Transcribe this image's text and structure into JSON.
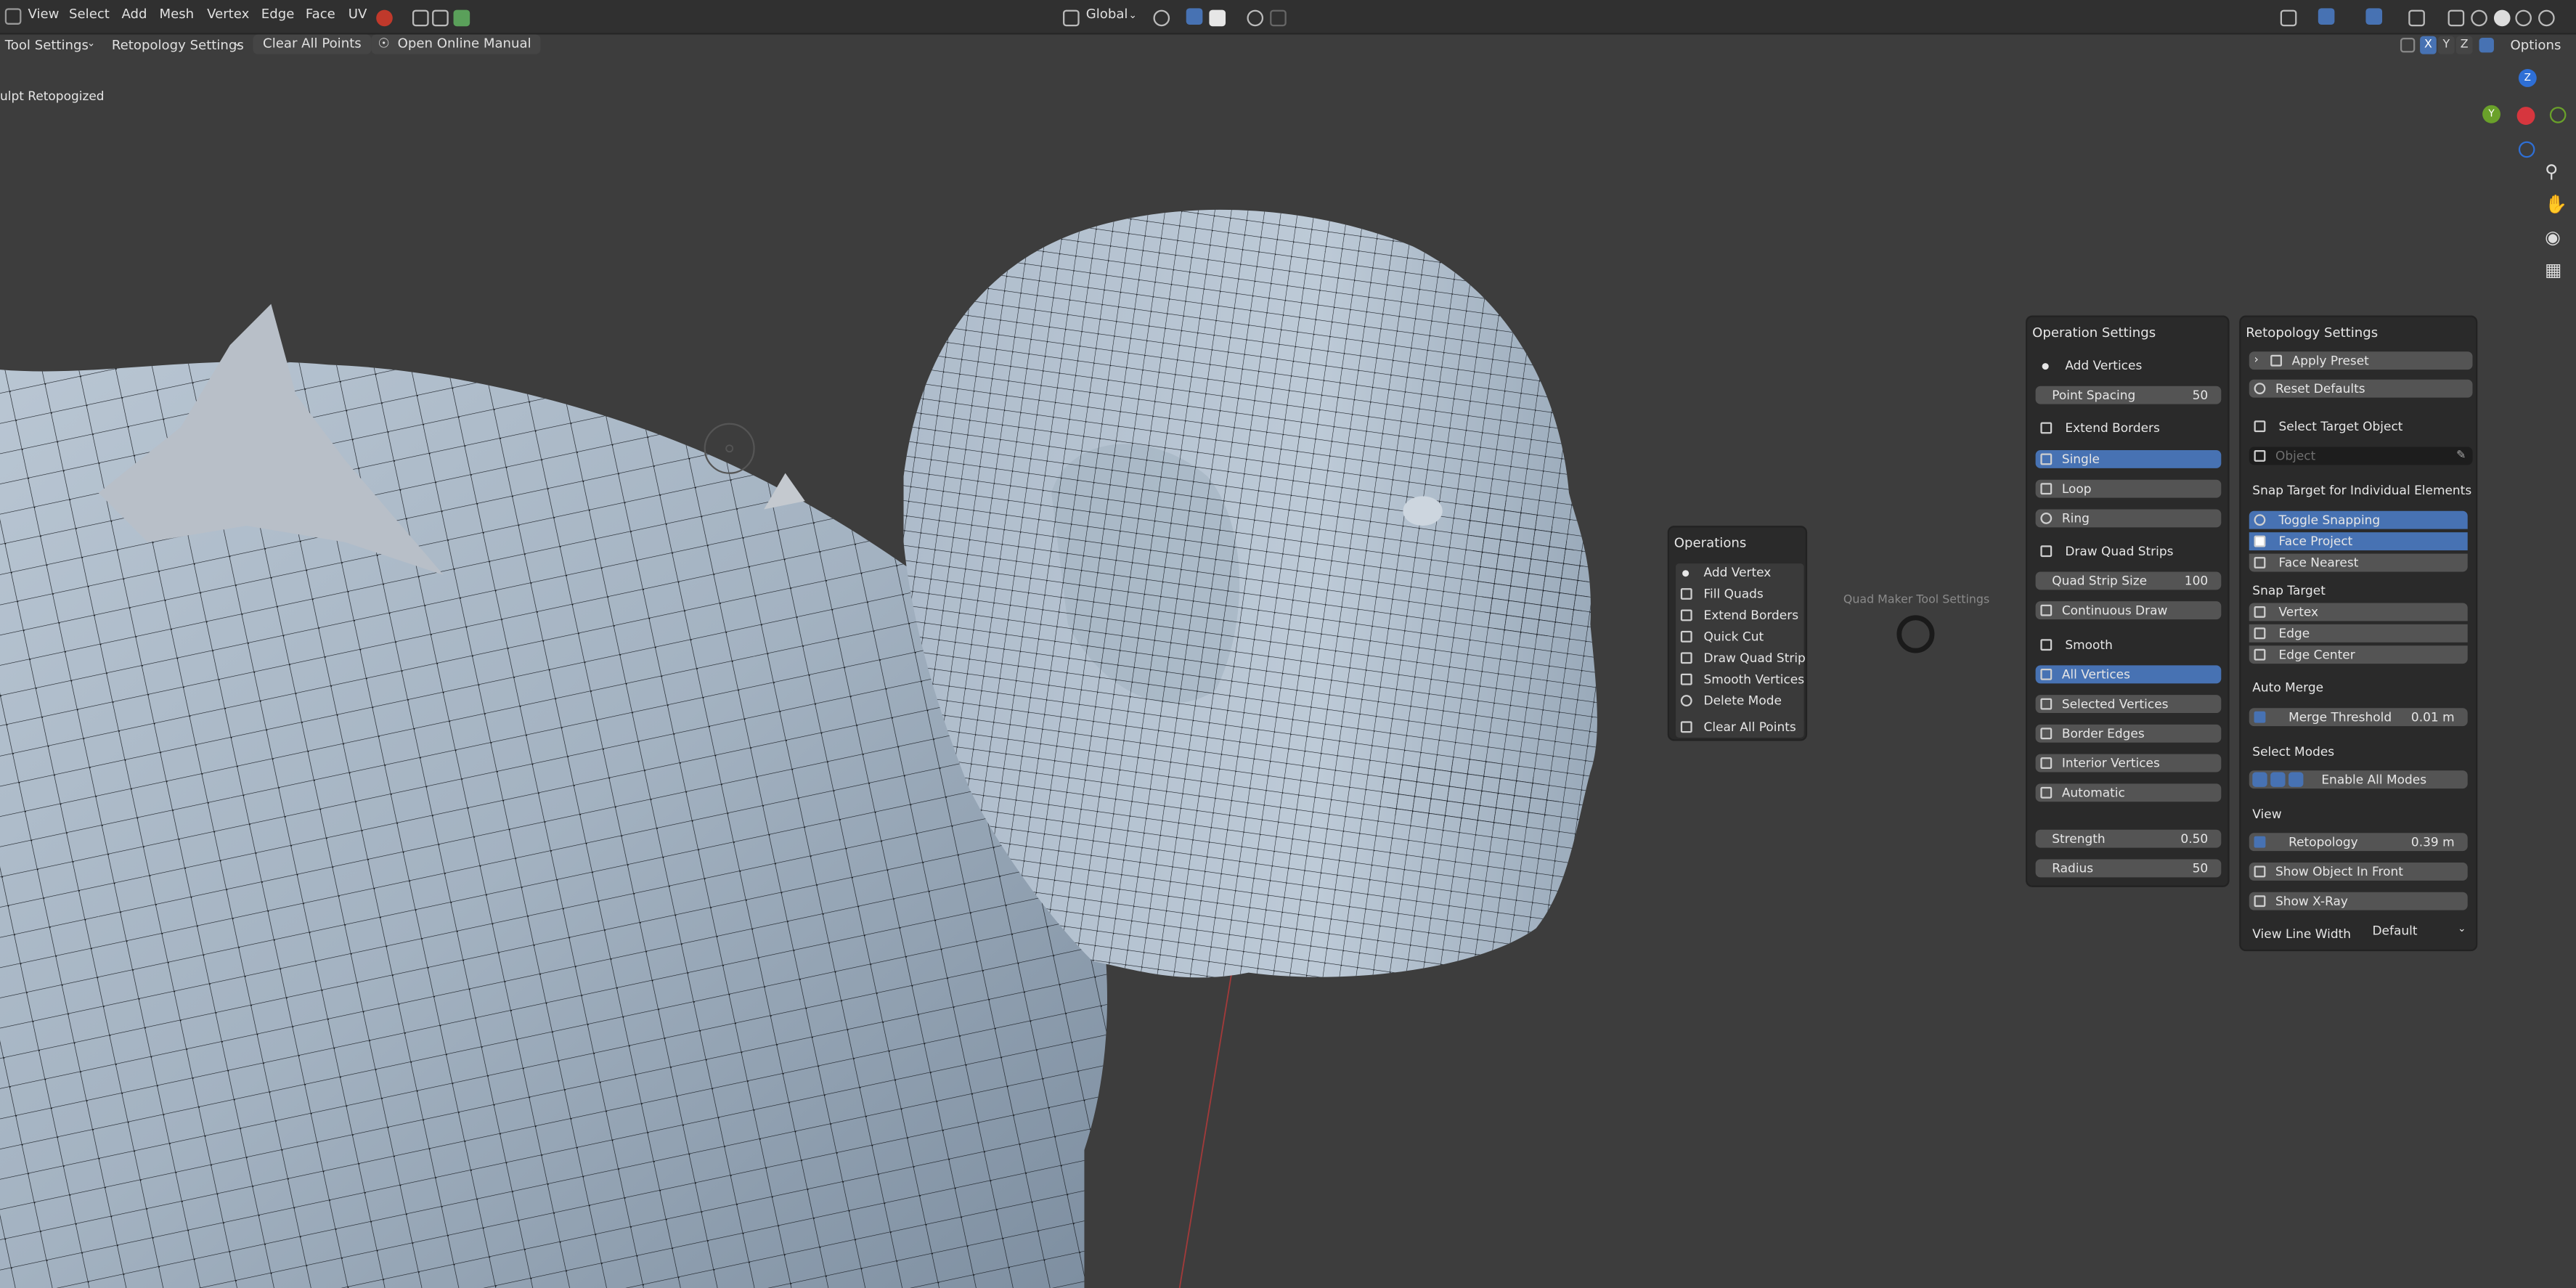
{
  "menubar": {
    "menus": [
      "View",
      "Select",
      "Add",
      "Mesh",
      "Vertex",
      "Edge",
      "Face",
      "UV"
    ],
    "orientation": "Global",
    "options_label": "Options",
    "axes": [
      "X",
      "Y",
      "Z"
    ]
  },
  "toolbar": {
    "tool_settings": "Tool Settings",
    "retopo_settings": "Retopology Settings",
    "clear_all_points": "Clear All Points",
    "open_manual": "Open Online Manual"
  },
  "viewport": {
    "object_label": "ulpt Retopogized",
    "quad_maker_label": "Quad Maker Tool Settings",
    "gizmo": {
      "z": "Z",
      "y": "Y"
    }
  },
  "operations": {
    "title": "Operations",
    "items": [
      {
        "label": "Add Vertex",
        "icon": "dot-icon"
      },
      {
        "label": "Fill Quads",
        "icon": "fill-icon"
      },
      {
        "label": "Extend Borders",
        "icon": "border-icon"
      },
      {
        "label": "Quick Cut",
        "icon": "cut-icon"
      },
      {
        "label": "Draw Quad Strip",
        "icon": "brush-icon"
      },
      {
        "label": "Smooth Vertices",
        "icon": "grid-dots-icon"
      },
      {
        "label": "Delete Mode",
        "icon": "delete-icon"
      }
    ],
    "clear_all": "Clear All Points"
  },
  "operation_settings": {
    "title": "Operation Settings",
    "add_vertices": "Add Vertices",
    "point_spacing": {
      "label": "Point Spacing",
      "value": "50"
    },
    "extend_borders": "Extend Borders",
    "single": "Single",
    "loop": "Loop",
    "ring": "Ring",
    "draw_quad_strips": "Draw Quad Strips",
    "quad_strip_size": {
      "label": "Quad Strip Size",
      "value": "100"
    },
    "continuous_draw": "Continuous Draw",
    "smooth": "Smooth",
    "all_vertices": "All Vertices",
    "selected_vertices": "Selected Vertices",
    "border_edges": "Border Edges",
    "interior_vertices": "Interior Vertices",
    "automatic": "Automatic",
    "strength": {
      "label": "Strength",
      "value": "0.50"
    },
    "radius": {
      "label": "Radius",
      "value": "50"
    }
  },
  "retopology_settings": {
    "title": "Retopology Settings",
    "apply_preset": "Apply Preset",
    "reset_defaults": "Reset Defaults",
    "select_target_object": "Select Target Object",
    "object_placeholder": "Object",
    "snap_target_individual": "Snap Target for Individual Elements",
    "toggle_snapping": "Toggle Snapping",
    "face_project": "Face Project",
    "face_nearest": "Face Nearest",
    "snap_target": "Snap Target",
    "vertex": "Vertex",
    "edge": "Edge",
    "edge_center": "Edge Center",
    "auto_merge": "Auto Merge",
    "merge_threshold": {
      "label": "Merge Threshold",
      "value": "0.01 m"
    },
    "select_modes": "Select Modes",
    "enable_all_modes": "Enable All Modes",
    "view": "View",
    "retopology": {
      "label": "Retopology",
      "value": "0.39 m"
    },
    "show_object_in_front": "Show Object In Front",
    "show_xray": "Show X-Ray",
    "view_line_width": {
      "label": "View Line Width",
      "value": "Default"
    }
  },
  "colors": {
    "accent": "#4772b3",
    "panel": "#2a2a2a",
    "button": "#545454",
    "viewport": "#3d3d3d"
  }
}
